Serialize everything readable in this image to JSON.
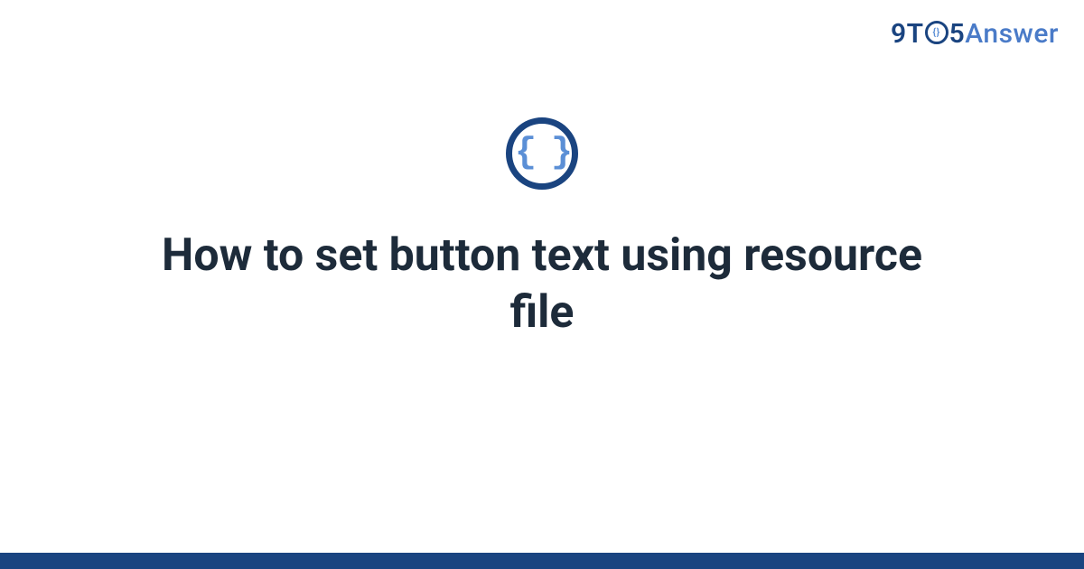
{
  "brand": {
    "part1": "9T",
    "o_inner": "{}",
    "part2": "5",
    "part3": "Answer"
  },
  "category_icon": {
    "name": "code-braces-icon",
    "glyph": "{ }"
  },
  "title": "How to set button text using resource file",
  "colors": {
    "brand_dark": "#1a4480",
    "brand_light": "#4a7bc8",
    "accent": "#5b8fd6",
    "title_text": "#1d2b3a"
  }
}
